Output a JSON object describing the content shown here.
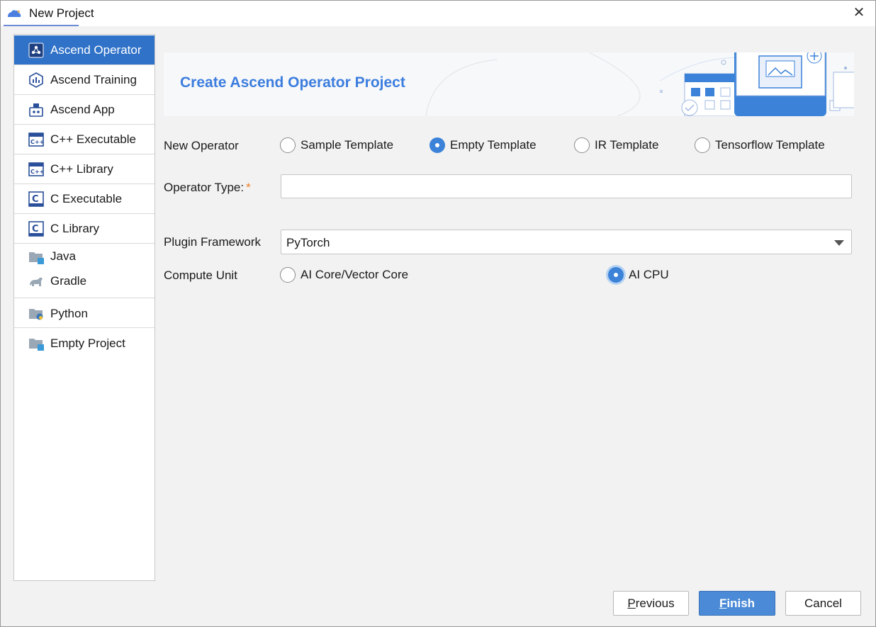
{
  "window": {
    "title": "New Project",
    "close_glyph": "✕"
  },
  "sidebar": {
    "items": [
      {
        "label": "Ascend Operator",
        "icon": "ascend-operator-icon"
      },
      {
        "label": "Ascend Training",
        "icon": "ascend-training-icon"
      },
      {
        "label": "Ascend App",
        "icon": "ascend-app-icon"
      },
      {
        "label": "C++ Executable",
        "icon": "cpp-icon"
      },
      {
        "label": "C++ Library",
        "icon": "cpp-icon"
      },
      {
        "label": "C Executable",
        "icon": "c-icon"
      },
      {
        "label": "C Library",
        "icon": "c-icon"
      },
      {
        "label": "Java",
        "icon": "java-folder-icon"
      },
      {
        "label": "Gradle",
        "icon": "gradle-elephant-icon"
      },
      {
        "label": "Python",
        "icon": "python-folder-icon"
      },
      {
        "label": "Empty Project",
        "icon": "empty-project-icon"
      }
    ],
    "selected": "Ascend Operator"
  },
  "banner": {
    "title": "Create Ascend Operator Project"
  },
  "form": {
    "new_operator": {
      "label": "New Operator",
      "options": [
        "Sample Template",
        "Empty Template",
        "IR Template",
        "Tensorflow Template"
      ],
      "selected": "Empty Template"
    },
    "operator_type": {
      "label": "Operator Type:",
      "required_mark": "*",
      "value": ""
    },
    "plugin_framework": {
      "label": "Plugin Framework",
      "value": "PyTorch"
    },
    "compute_unit": {
      "label": "Compute Unit",
      "options": [
        "AI Core/Vector Core",
        "AI CPU"
      ],
      "selected": "AI CPU"
    }
  },
  "buttons": {
    "previous": {
      "mnemonic": "P",
      "rest": "revious"
    },
    "finish": {
      "mnemonic": "F",
      "rest": "inish"
    },
    "cancel": {
      "label": "Cancel"
    }
  },
  "colors": {
    "accent": "#2f72c8",
    "banner_title": "#3c7dde",
    "required": "#f07d20"
  }
}
